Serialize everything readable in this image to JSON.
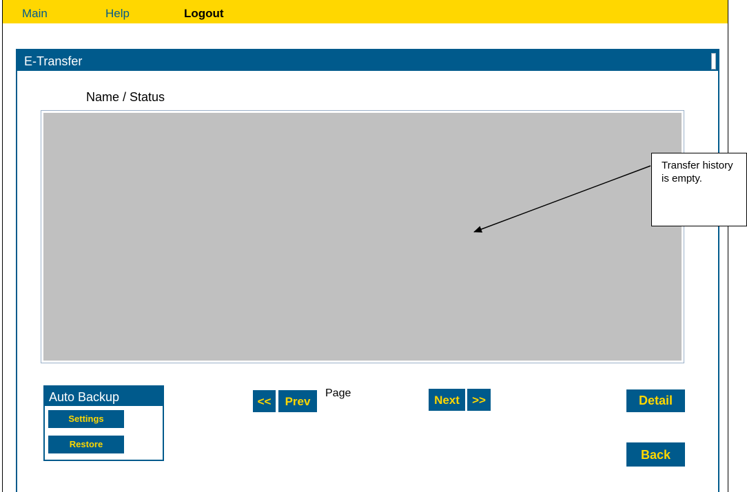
{
  "nav": {
    "main": "Main",
    "help": "Help",
    "logout": "Logout"
  },
  "panel": {
    "title": "E-Transfer",
    "column_header": "Name / Status"
  },
  "auto_backup": {
    "title": "Auto Backup",
    "settings_label": "Settings",
    "restore_label": "Restore"
  },
  "pagination": {
    "first_label": "<<",
    "prev_label": "Prev",
    "page_label": "Page",
    "next_label": "Next",
    "last_label": ">>"
  },
  "actions": {
    "detail_label": "Detail",
    "back_label": "Back"
  },
  "callout": {
    "text": "Transfer history is empty."
  },
  "colors": {
    "topbar": "#ffd700",
    "panel_blue": "#005a8c",
    "button_text": "#ffd700",
    "list_fill": "#c0c0c0"
  }
}
